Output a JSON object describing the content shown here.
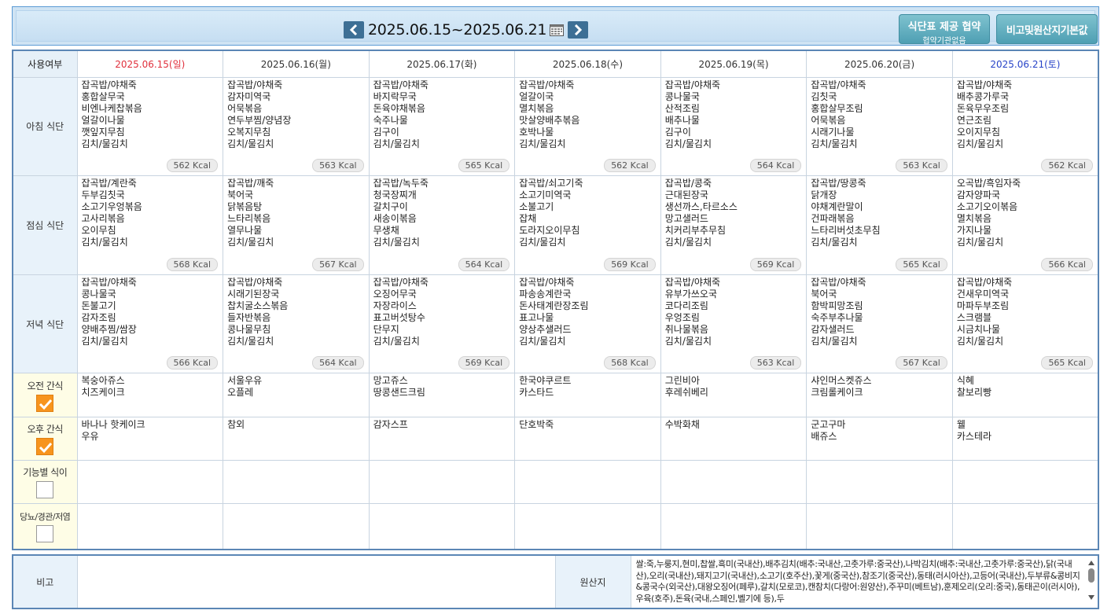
{
  "header": {
    "date_range": "2025.06.15~2025.06.21",
    "agree_button_title": "식단표 제공 협약",
    "agree_button_sub": "협약기관없음",
    "note_button": "비고및원산지기본값"
  },
  "table": {
    "corner_label": "사용여부",
    "days": [
      {
        "label": "2025.06.15(일)",
        "kind": "sun"
      },
      {
        "label": "2025.06.16(월)",
        "kind": "wd"
      },
      {
        "label": "2025.06.17(화)",
        "kind": "wd"
      },
      {
        "label": "2025.06.18(수)",
        "kind": "wd"
      },
      {
        "label": "2025.06.19(목)",
        "kind": "wd"
      },
      {
        "label": "2025.06.20(금)",
        "kind": "wd"
      },
      {
        "label": "2025.06.21(토)",
        "kind": "sat"
      }
    ],
    "rows": [
      {
        "label": "아침 식단",
        "cells": [
          {
            "items": [
              "잡곡밥/야채죽",
              "홍합살무국",
              "비엔나케찹볶음",
              "얼갈이나물",
              "깻잎지무침",
              "김치/물김치"
            ],
            "kcal": "562 Kcal"
          },
          {
            "items": [
              "잡곡밥/야채죽",
              "감자미역국",
              "어묵볶음",
              "연두부찜/양념장",
              "오복지무침",
              "김치/물김치"
            ],
            "kcal": "563 Kcal"
          },
          {
            "items": [
              "잡곡밥/야채죽",
              "바지락무국",
              "돈육야채볶음",
              "숙주나물",
              "김구이",
              "김치/물김치"
            ],
            "kcal": "565 Kcal"
          },
          {
            "items": [
              "잡곡밥/야채죽",
              "얼갈이국",
              "멸치볶음",
              "맛살양배추볶음",
              "호박나물",
              "김치/물김치"
            ],
            "kcal": "562 Kcal"
          },
          {
            "items": [
              "잡곡밥/야채죽",
              "콩나물국",
              "산적조림",
              "배추나물",
              "김구이",
              "김치/물김치"
            ],
            "kcal": "564 Kcal"
          },
          {
            "items": [
              "잡곡밥/야채죽",
              "김칫국",
              "홍합살무조림",
              "어묵볶음",
              "시래기나물",
              "김치/물김치"
            ],
            "kcal": "563 Kcal"
          },
          {
            "items": [
              "잡곡밥/야채죽",
              "배추콩가루국",
              "돈육무우조림",
              "연근조림",
              "오이지무침",
              "김치/물김치"
            ],
            "kcal": "562 Kcal"
          }
        ]
      },
      {
        "label": "점심 식단",
        "cells": [
          {
            "items": [
              "잡곡밥/계란죽",
              "두부김칫국",
              "소고기우엉볶음",
              "고사리볶음",
              "오이무침",
              "김치/물김치"
            ],
            "kcal": "568 Kcal"
          },
          {
            "items": [
              "잡곡밥/깨죽",
              "북어국",
              "닭볶음탕",
              "느타리볶음",
              "열무나물",
              "김치/물김치"
            ],
            "kcal": "567 Kcal"
          },
          {
            "items": [
              "잡곡밥/녹두죽",
              "청국장찌개",
              "갈치구이",
              "새송이볶음",
              "무생채",
              "김치/물김치"
            ],
            "kcal": "564 Kcal"
          },
          {
            "items": [
              "잡곡밥/쇠고기죽",
              "소고기미역국",
              "소불고기",
              "잡채",
              "도라지오이무침",
              "김치/물김치"
            ],
            "kcal": "569 Kcal"
          },
          {
            "items": [
              "잡곡밥/콩죽",
              "근대된장국",
              "생선까스,타르소스",
              "망고샐러드",
              "치커리부추무침",
              "김치/물김치"
            ],
            "kcal": "569 Kcal"
          },
          {
            "items": [
              "잡곡밥/땅콩죽",
              "닭개장",
              "야채계란말이",
              "건파래볶음",
              "느타리버섯초무침",
              "김치/물김치"
            ],
            "kcal": "565 Kcal"
          },
          {
            "items": [
              "오곡밥/흑임자죽",
              "감자양파국",
              "소고기오이볶음",
              "멸치볶음",
              "가지나물",
              "김치/물김치"
            ],
            "kcal": "566 Kcal"
          }
        ]
      },
      {
        "label": "저녁 식단",
        "cells": [
          {
            "items": [
              "잡곡밥/야채죽",
              "콩나물국",
              "돈불고기",
              "감자조림",
              "양배추찜/쌈장",
              "김치/물김치"
            ],
            "kcal": "566 Kcal"
          },
          {
            "items": [
              "잡곡밥/야채죽",
              "시래기된장국",
              "찹치굴소스볶음",
              "들자반볶음",
              "콩나물무침",
              "김치/물김치"
            ],
            "kcal": "564 Kcal"
          },
          {
            "items": [
              "잡곡밥/야채죽",
              "오징어무국",
              "자장라이스",
              "표고버섯탕수",
              "단무지",
              "김치/물김치"
            ],
            "kcal": "569 Kcal"
          },
          {
            "items": [
              "잡곡밥/야채죽",
              "파송송계란국",
              "돈사태계란장조림",
              "표고나물",
              "양상추샐러드",
              "김치/물김치"
            ],
            "kcal": "568 Kcal"
          },
          {
            "items": [
              "잡곡밥/야채죽",
              "유부가쓰오국",
              "코다리조림",
              "우엉조림",
              "취나물볶음",
              "김치/물김치"
            ],
            "kcal": "563 Kcal"
          },
          {
            "items": [
              "잡곡밥/야채죽",
              "북어국",
              "함박피망조림",
              "숙주부추나물",
              "감자샐러드",
              "김치/물김치"
            ],
            "kcal": "567 Kcal"
          },
          {
            "items": [
              "잡곡밥/야채죽",
              "건새우미역국",
              "마파두부조림",
              "스크램블",
              "시금치나물",
              "김치/물김치"
            ],
            "kcal": "565 Kcal"
          }
        ]
      }
    ],
    "snack_rows": [
      {
        "label": "오전 간식",
        "checked": true,
        "cells": [
          [
            "복숭아쥬스",
            "치즈케이크"
          ],
          [
            "서울우유",
            "오플레"
          ],
          [
            "망고쥬스",
            "땅콩샌드크림"
          ],
          [
            "한국야쿠르트",
            "카스타드"
          ],
          [
            "그린비아",
            "후레쉬베리"
          ],
          [
            "샤인머스켓쥬스",
            "크림롤케이크"
          ],
          [
            "식혜",
            "찰보리빵"
          ]
        ]
      },
      {
        "label": "오후 간식",
        "checked": true,
        "cells": [
          [
            "바나나 핫케이크",
            "우유"
          ],
          [
            "참외"
          ],
          [
            "감자스프"
          ],
          [
            "단호박죽"
          ],
          [
            "수박화채"
          ],
          [
            "군고구마",
            "배쥬스"
          ],
          [
            "웰",
            "카스테라"
          ]
        ]
      },
      {
        "label": "기능별 식이",
        "checked": false,
        "cells": [
          [],
          [],
          [],
          [],
          [],
          [],
          []
        ]
      },
      {
        "label": "당뇨/경관/저염",
        "checked": false,
        "cells": [
          [],
          [],
          [],
          [],
          [],
          [],
          []
        ]
      }
    ]
  },
  "notes": {
    "note_label": "비고",
    "note_value": "",
    "origin_label": "원산지",
    "origin_text": "쌀:죽,누룽지,현미,찹쌀,흑미(국내산),배추김치(배추:국내산,고춧가루:중국산),나박김치(배추:국내산,고춧가루:중국산),닭(국내산),오리(국내산),돼지고기(국내산),소고기(호주산),꽃게(중국산),참조기(중국산),동태(러시아산),고등어(국내산),두부류&콩비지&콩국수(외국산),대왕오징어(페루),갈치(모로코),캔참치(다랑어:원양산),주꾸미(베트남),훈제오리(오리:중국),동태곤이(러시아),우육(호주),돈육(국내,스페인,벨기에 등),두"
  }
}
